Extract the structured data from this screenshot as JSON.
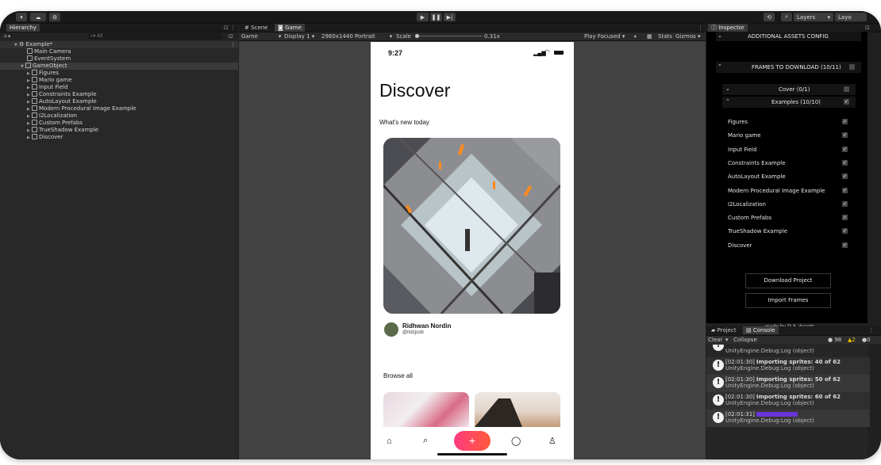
{
  "toolbar": {
    "layers_label": "Layers",
    "layout_label": "Layo"
  },
  "hierarchy": {
    "tab_label": "Hierarchy",
    "search_placeholder": "All",
    "scene_name": "Example*",
    "items": [
      {
        "label": "Main Camera"
      },
      {
        "label": "EventSystem"
      },
      {
        "label": "GameObject"
      },
      {
        "label": "Figures"
      },
      {
        "label": "Mario game"
      },
      {
        "label": "Input Field"
      },
      {
        "label": "Constraints Example"
      },
      {
        "label": "AutoLayout Example"
      },
      {
        "label": "Modern Procedural Image Example"
      },
      {
        "label": "I2Localization"
      },
      {
        "label": "Custom Prefabs"
      },
      {
        "label": "TrueShadow Example"
      },
      {
        "label": "Discover"
      }
    ]
  },
  "game": {
    "tab_scene": "Scene",
    "tab_game": "Game",
    "mode": "Game",
    "display": "Display 1",
    "resolution": "2960x1440 Portrait",
    "scale_label": "Scale",
    "scale_value": "0.31x",
    "scale_level": 0.0,
    "play_focused": "Play Focused",
    "stats": "Stats",
    "gizmos": "Gizmos"
  },
  "phone": {
    "time": "9:27",
    "title": "Discover",
    "subtitle": "What's new today",
    "author_name": "Ridhwan Nordin",
    "author_handle": "@ridzjcob",
    "browse": "Browse all",
    "add_icon": "plus-icon"
  },
  "inspector": {
    "tab_label": "Inspector",
    "additional": "ADDITIONAL ASSETS CONFIG",
    "frames": "FRAMES TO DOWNLOAD (10/11)",
    "cover": "Cover (0/1)",
    "examples": "Examples (10/10)",
    "items": [
      {
        "label": "Figures",
        "checked": true
      },
      {
        "label": "Mario game",
        "checked": true
      },
      {
        "label": "Input Field",
        "checked": true
      },
      {
        "label": "Constraints Example",
        "checked": true
      },
      {
        "label": "AutoLayout Example",
        "checked": true
      },
      {
        "label": "Modern Procedural Image Example",
        "checked": true
      },
      {
        "label": "I2Localization",
        "checked": true
      },
      {
        "label": "Custom Prefabs",
        "checked": true
      },
      {
        "label": "TrueShadow Example",
        "checked": true
      },
      {
        "label": "Discover",
        "checked": true
      }
    ],
    "download_btn": "Download Project",
    "import_btn": "Import Frames",
    "credit": "made by D.A. Assets"
  },
  "console": {
    "tab_project": "Project",
    "tab_console": "Console",
    "clear": "Clear",
    "collapse": "Collapse",
    "count_info": "98",
    "count_warn": "2",
    "count_err": "0",
    "source": "UnityEngine.Debug:Log (object)",
    "logs": [
      {
        "time": "[02:01:30]",
        "msg": "Importing sprites: 40 of 62"
      },
      {
        "time": "[02:01:30]",
        "msg": "Importing sprites: 50 of 62"
      },
      {
        "time": "[02:01:30]",
        "msg": "Importing sprites: 60 of 62"
      },
      {
        "time": "[02:01:31]",
        "msg": ""
      }
    ]
  },
  "colors": {
    "accent_pink": "#ff3b7f",
    "accent_orange": "#ff5a3a",
    "msg_purple": "#6a35d6"
  }
}
